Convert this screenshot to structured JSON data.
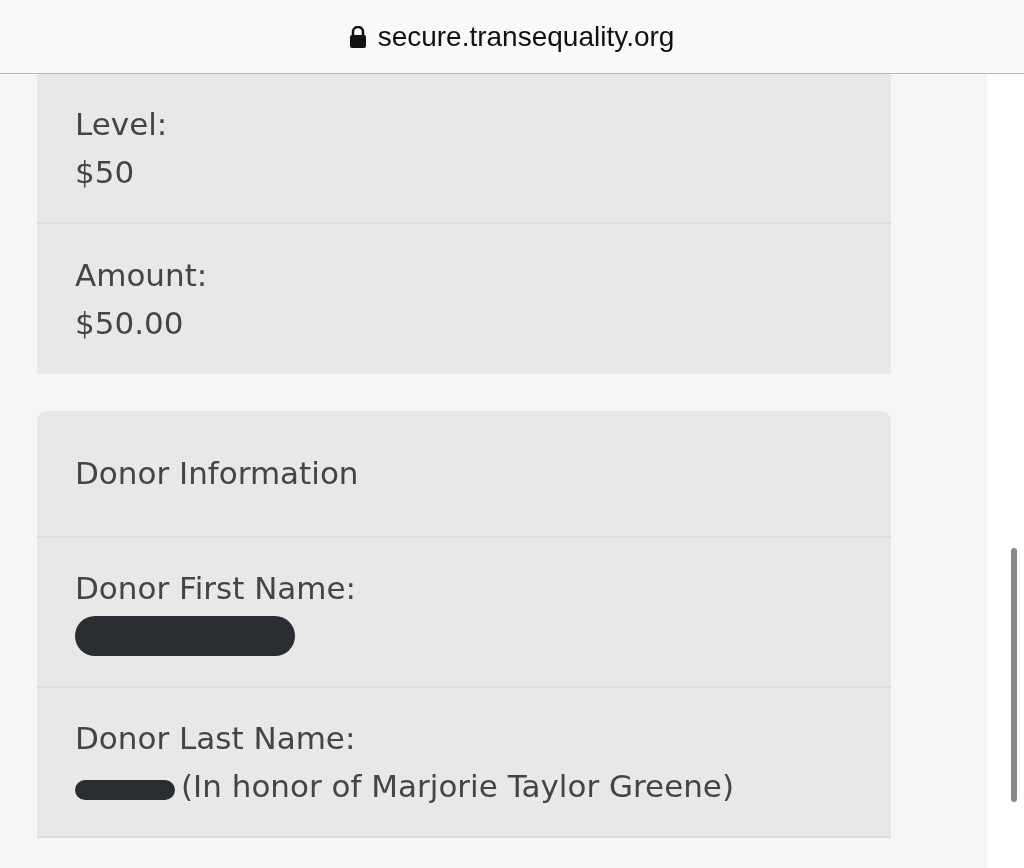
{
  "address_bar": {
    "url": "secure.transequality.org",
    "secure": true
  },
  "summary": [
    {
      "label": "Level:",
      "value": "$50"
    },
    {
      "label": "Amount:",
      "value": "$50.00"
    }
  ],
  "donor_information": {
    "title": "Donor Information",
    "fields": [
      {
        "label": "Donor First Name:",
        "redacted": true
      },
      {
        "label": "Donor Last Name:",
        "redacted": true,
        "value": "(In honor of Marjorie Taylor Greene)"
      }
    ]
  }
}
